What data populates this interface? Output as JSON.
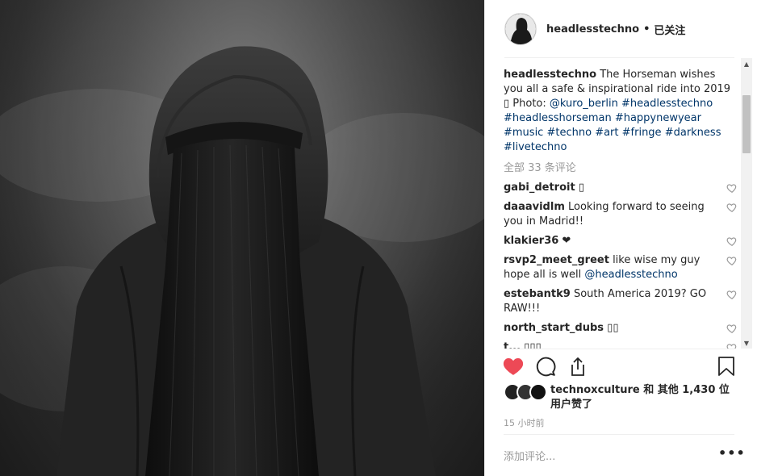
{
  "post": {
    "username": "headlesstechno",
    "follow_status": "已关注",
    "separator": "•",
    "caption_text_1": " The Horseman wishes you all a safe & inspirational ride into 2019 ",
    "caption_emoji": "▯",
    "caption_text_2": " Photo: ",
    "caption_mention": "@kuro_berlin",
    "hashtags": [
      "#headlesstechno",
      "#headlesshorseman",
      "#happynewyear",
      "#music",
      "#techno",
      "#art",
      "#fringe",
      "#darkness",
      "#livetechno"
    ],
    "all_comments": "全部 33 条评论",
    "time_ago": "15 小时前",
    "add_comment_placeholder": "添加评论...",
    "more_label": "•••"
  },
  "comments": [
    {
      "user": "gabi_detroit",
      "text": " ▯",
      "mention": ""
    },
    {
      "user": "daaavidlm",
      "text": " Looking forward to seeing you in Madrid!!",
      "mention": ""
    },
    {
      "user": "klakier36",
      "text": " ❤",
      "mention": ""
    },
    {
      "user": "rsvp2_meet_greet",
      "text": " like wise my guy hope all is well ",
      "mention": "@headlesstechno"
    },
    {
      "user": "estebantk9",
      "text": " South America 2019? GO RAW!!!",
      "mention": ""
    },
    {
      "user": "north_start_dubs",
      "text": " ▯▯",
      "mention": ""
    },
    {
      "user": "t...",
      "text": " ▯▯▯",
      "mention": ""
    }
  ],
  "likes": {
    "liker": "technoxculture",
    "rest": " 和 其他 1,430 位用户赞了"
  },
  "colors": {
    "heart_liked": "#ed4956",
    "hashtag": "#003569",
    "muted": "#999999"
  }
}
